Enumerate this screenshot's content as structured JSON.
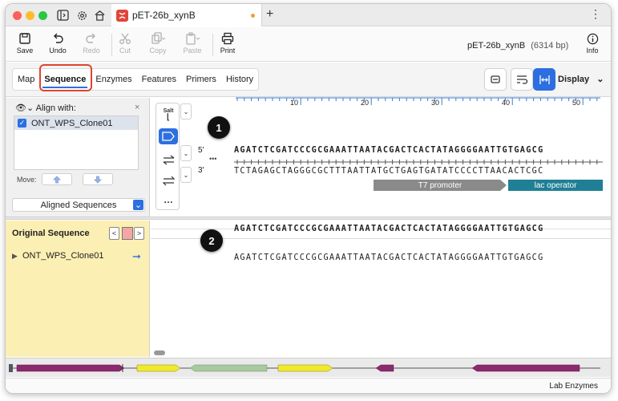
{
  "window": {
    "tab_title": "pET-26b_xynB",
    "add_tab": "+",
    "menu": "⋮"
  },
  "toolbar": {
    "save": "Save",
    "undo": "Undo",
    "redo": "Redo",
    "cut": "Cut",
    "copy": "Copy",
    "paste": "Paste",
    "print": "Print",
    "info": "Info",
    "doc_name": "pET-26b_xynB",
    "doc_length": "(6314 bp)"
  },
  "view_tabs": [
    "Map",
    "Sequence",
    "Enzymes",
    "Features",
    "Primers",
    "History"
  ],
  "active_view_tab": "Sequence",
  "display_label": "Display",
  "align_panel": {
    "title": "Align with:",
    "close": "×",
    "items": [
      {
        "label": "ONT_WPS_Clone01",
        "checked": true
      }
    ],
    "move_label": "Move:",
    "aligned_select": "Aligned Sequences"
  },
  "vertical_tools": {
    "salt_label": "Salt",
    "more": "…"
  },
  "ruler": {
    "ticks": [
      "10",
      "20",
      "30",
      "40",
      "50"
    ]
  },
  "sequence": {
    "strand5_label": "5'",
    "strand3_label": "3'",
    "ellipsis": "•••",
    "top_strand": "AGATCTCGATCCCGCGAAATTAATACGACTCACTATAGGGGAATTGTGAGCG",
    "bottom_strand": "TCTAGAGCTAGGGCGCTTTAATTATGCTGAGTGATATCCCCTTAACACTCGC",
    "features": [
      {
        "label": "T7 promoter",
        "color": "#8a8a8a"
      },
      {
        "label": "lac operator",
        "color": "#1f7f95"
      }
    ]
  },
  "markers": [
    "1",
    "2"
  ],
  "original_panel": {
    "title": "Original Sequence",
    "prev": "<",
    "next": ">",
    "item": "ONT_WPS_Clone01",
    "reference_seq": "AGATCTCGATCCCGCGAAATTAATACGACTCACTATAGGGGAATTGTGAGCG",
    "aligned_seq": "AGATCTCGATCCCGCGAAATTAATACGACTCACTATAGGGGAATTGTGAGCG"
  },
  "status_bar": {
    "text": "Lab Enzymes"
  },
  "colors": {
    "accent": "#2d6fe0",
    "highlight": "#e0442f",
    "original_panel_bg": "#fcefb4",
    "feature_purple": "#8b2a6f",
    "feature_yellow": "#f1ea2a",
    "feature_green": "#a8c9a0"
  }
}
